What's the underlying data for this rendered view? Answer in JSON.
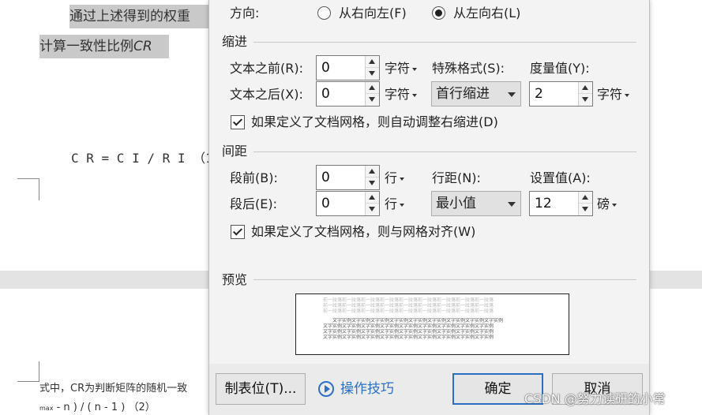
{
  "document": {
    "para_line1": "通过上述得到的权重",
    "para_line2": "计算一致性比例",
    "para_line2_italic": "CR",
    "formula": "C R = C I / R I （1",
    "footer_line1": "式中，CR为判断矩阵的随机一致",
    "footer_line2_sub": "max",
    "footer_line2": " - n ) / ( n - 1 ) （2）"
  },
  "dialog": {
    "direction": {
      "label": "方向:",
      "rtl": "从右向左(F)",
      "ltr": "从左向右(L)",
      "selected": "ltr"
    },
    "indent": {
      "title": "缩进",
      "before_label": "文本之前(R):",
      "before_value": "0",
      "before_unit": "字符",
      "after_label": "文本之后(X):",
      "after_value": "0",
      "after_unit": "字符",
      "special_label": "特殊格式(S):",
      "special_value": "首行缩进",
      "measure_label": "度量值(Y):",
      "measure_value": "2",
      "measure_unit": "字符",
      "grid_checkbox": "如果定义了文档网格，则自动调整右缩进(D)",
      "grid_checked": true
    },
    "spacing": {
      "title": "间距",
      "before_label": "段前(B):",
      "before_value": "0",
      "before_unit": "行",
      "after_label": "段后(E):",
      "after_value": "0",
      "after_unit": "行",
      "line_label": "行距(N):",
      "line_value": "最小值",
      "setting_label": "设置值(A):",
      "setting_value": "12",
      "setting_unit": "磅",
      "grid_checkbox": "如果定义了文档网格，则与网格对齐(W)",
      "grid_checked": true
    },
    "preview": {
      "title": "预览",
      "prev_paragraph": "前一段落前一段落前一段落前一段落前一段落前一段落前一段落前一段落前一段落",
      "sample_text": "文字实例文字实例文字实例文字实例文字实例文字实例文字实例文字实例文字实例"
    },
    "buttons": {
      "tabs": "制表位(T)...",
      "tips": "操作技巧",
      "ok": "确定",
      "cancel": "取消"
    }
  },
  "watermark": "CSDN @努力读研的小常",
  "colors": {
    "accent": "#2b6fc2",
    "dialog_bg": "#f3f3f3",
    "page_gap": "#e3e3e3",
    "highlight": "#c9c9c9"
  }
}
